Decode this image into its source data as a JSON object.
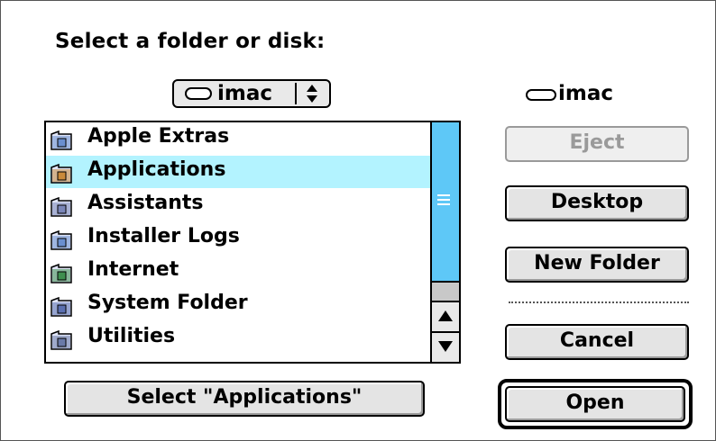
{
  "dialog": {
    "prompt": "Select a folder or disk:",
    "volume_popup": {
      "selected": "imac"
    },
    "disk_label": "imac"
  },
  "file_list": {
    "items": [
      {
        "name": "Apple Extras",
        "icon": "folder-icon"
      },
      {
        "name": "Applications",
        "icon": "applications-folder-icon",
        "selected": true
      },
      {
        "name": "Assistants",
        "icon": "assistants-folder-icon"
      },
      {
        "name": "Installer Logs",
        "icon": "folder-icon"
      },
      {
        "name": "Internet",
        "icon": "internet-folder-icon"
      },
      {
        "name": "System Folder",
        "icon": "system-folder-icon"
      },
      {
        "name": "Utilities",
        "icon": "utilities-folder-icon"
      }
    ],
    "selection_color": "#b3f3ff"
  },
  "buttons": {
    "eject": "Eject",
    "desktop": "Desktop",
    "new_folder": "New Folder",
    "cancel": "Cancel",
    "open": "Open",
    "select": "Select \"Applications\""
  },
  "colors": {
    "scrollbar": "#5ec8f7",
    "button": "#e4e4e4"
  }
}
